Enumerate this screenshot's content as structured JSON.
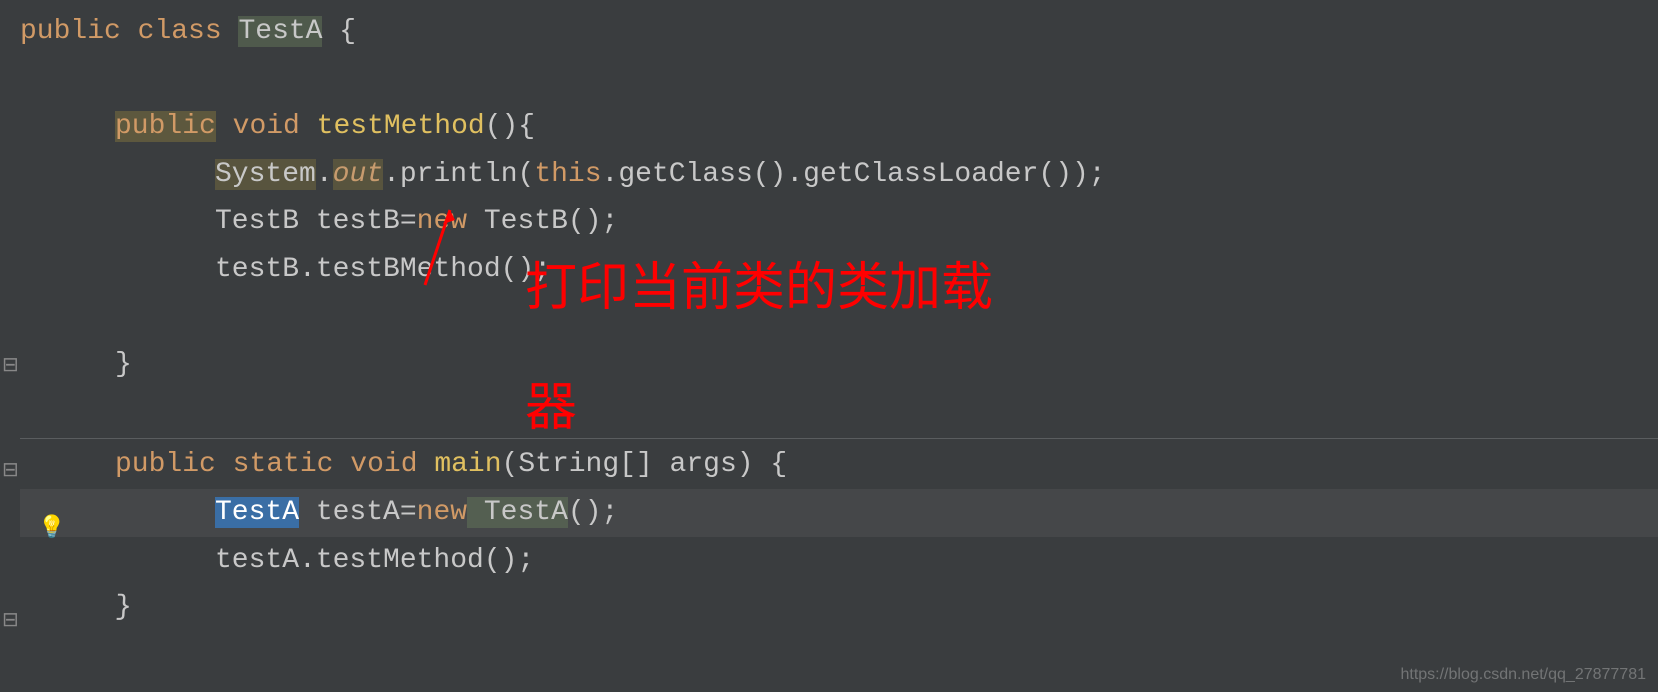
{
  "code": {
    "line1": {
      "kw1": "public",
      "kw2": "class",
      "classname": "TestA",
      "brace": " {"
    },
    "line2": {
      "kw1": "public",
      "kw2": "void",
      "method": "testMethod",
      "rest": "(){"
    },
    "line3": {
      "sys": "System",
      "dot1": ".",
      "out": "out",
      "dot2": ".",
      "println": "println",
      "paren1": "(",
      "this": "this",
      "rest": ".getClass().getClassLoader());"
    },
    "line4": {
      "type": "TestB",
      "var": " testB=",
      "new": "new",
      "ctor": " TestB",
      "rest": "();"
    },
    "line5": {
      "text": "testB.testBMethod();"
    },
    "line6": {
      "brace": "}"
    },
    "line7": {
      "kw1": "public",
      "kw2": "static",
      "kw3": "void",
      "method": "main",
      "params": "(String[] args) {"
    },
    "line8": {
      "type": "TestA",
      "var": " testA=",
      "new": "new",
      "ctor": " TestA",
      "rest": "();"
    },
    "line9": {
      "text": "testA.testMethod();"
    },
    "line10": {
      "brace": "}"
    }
  },
  "annotation": {
    "line1": "打印当前类的类加载",
    "line2": "器"
  },
  "watermark": "https://blog.csdn.net/qq_27877781"
}
